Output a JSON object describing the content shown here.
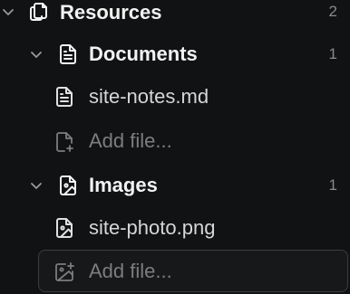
{
  "tree": {
    "root": {
      "label": "Resources",
      "count": "2",
      "icon": "folder-copy-icon",
      "expanded": true
    },
    "groups": [
      {
        "label": "Documents",
        "count": "1",
        "icon": "document-icon",
        "expanded": true,
        "files": [
          {
            "label": "site-notes.md",
            "icon": "document-icon"
          }
        ],
        "add_label": "Add file...",
        "add_icon": "file-plus-icon"
      },
      {
        "label": "Images",
        "count": "1",
        "icon": "image-file-icon",
        "expanded": true,
        "files": [
          {
            "label": "site-photo.png",
            "icon": "image-file-icon"
          }
        ],
        "add_label": "Add file...",
        "add_icon": "image-plus-icon"
      }
    ]
  },
  "colors": {
    "background": "#111214",
    "text": "#e6e6e6",
    "muted": "#7d7d7d",
    "focus_border": "#3c3d40"
  }
}
